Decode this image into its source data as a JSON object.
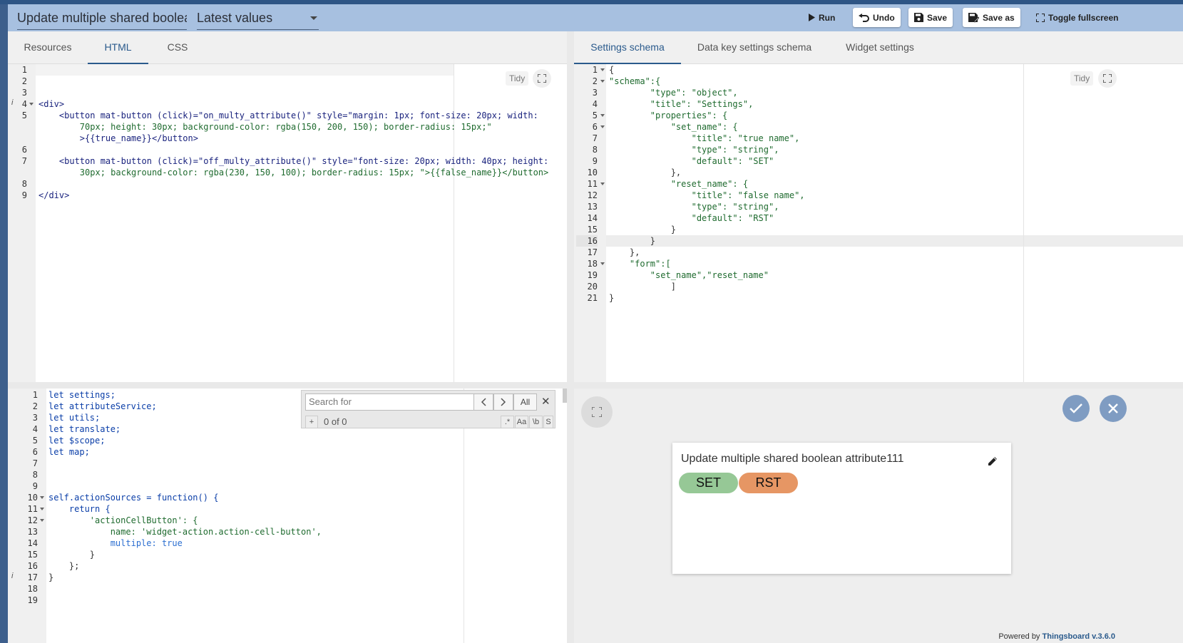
{
  "toolbar": {
    "widget_title": "Update multiple shared boolean",
    "widget_type": "Latest values",
    "run": "Run",
    "undo": "Undo",
    "save": "Save",
    "save_as": "Save as",
    "fullscreen": "Toggle fullscreen"
  },
  "left_tabs": [
    "Resources",
    "HTML",
    "CSS"
  ],
  "left_active_tab": "HTML",
  "right_tabs": [
    "Settings schema",
    "Data key settings schema",
    "Widget settings"
  ],
  "right_active_tab": "Settings schema",
  "tidy_label": "Tidy",
  "html_editor": {
    "line_numbers": [
      "1",
      "2",
      "3",
      "4",
      "5",
      "",
      "",
      "6",
      "7",
      "",
      "8",
      "9"
    ],
    "lines": [
      "",
      "",
      "",
      "<div>",
      "    <button mat-button (click)=\"on_multy_attribute()\" style=\"margin: 1px; font-size: 20px; width:",
      "        70px; height: 30px; background-color: rgba(150, 200, 150); border-radius: 15px;\"",
      "        >{{true_name}}</button>",
      "",
      "    <button mat-button (click)=\"off_multy_attribute()\" style=\"font-size: 20px; width: 40px; height:",
      "        30px; background-color: rgba(230, 150, 100); border-radius: 15px; \">{{false_name}}</button>",
      "",
      "</div>"
    ]
  },
  "settings_editor": {
    "lines": [
      "{",
      "\"schema\":{",
      "        \"type\": \"object\",",
      "        \"title\": \"Settings\",",
      "        \"properties\": {",
      "            \"set_name\": {",
      "                \"title\": \"true name\",",
      "                \"type\": \"string\",",
      "                \"default\": \"SET\"",
      "            },",
      "            \"reset_name\": {",
      "                \"title\": \"false name\",",
      "                \"type\": \"string\",",
      "                \"default\": \"RST\"",
      "            }",
      "        }",
      "    },",
      "    \"form\":[",
      "        \"set_name\",\"reset_name\"",
      "            ]",
      "}"
    ]
  },
  "js_editor": {
    "lines": [
      "let settings;",
      "let attributeService;",
      "let utils;",
      "let translate;",
      "let $scope;",
      "let map;",
      "",
      "",
      "",
      "self.actionSources = function() {",
      "    return {",
      "        'actionCellButton': {",
      "            name: 'widget-action.action-cell-button',",
      "            multiple: true",
      "        }",
      "    };",
      "}",
      "",
      ""
    ]
  },
  "search": {
    "placeholder": "Search for",
    "all": "All",
    "count": "0 of 0",
    "plus": "+",
    "opt_regex": ".*",
    "opt_case": "Aa",
    "opt_word": "\\b",
    "opt_sel": "S"
  },
  "preview": {
    "widget_title": "Update multiple shared boolean attribute111",
    "set_label": "SET",
    "rst_label": "RST",
    "set_color": "#96c896",
    "rst_color": "#e69664",
    "powered_prefix": "Powered by",
    "powered_brand": "Thingsboard v.3.6.0"
  }
}
